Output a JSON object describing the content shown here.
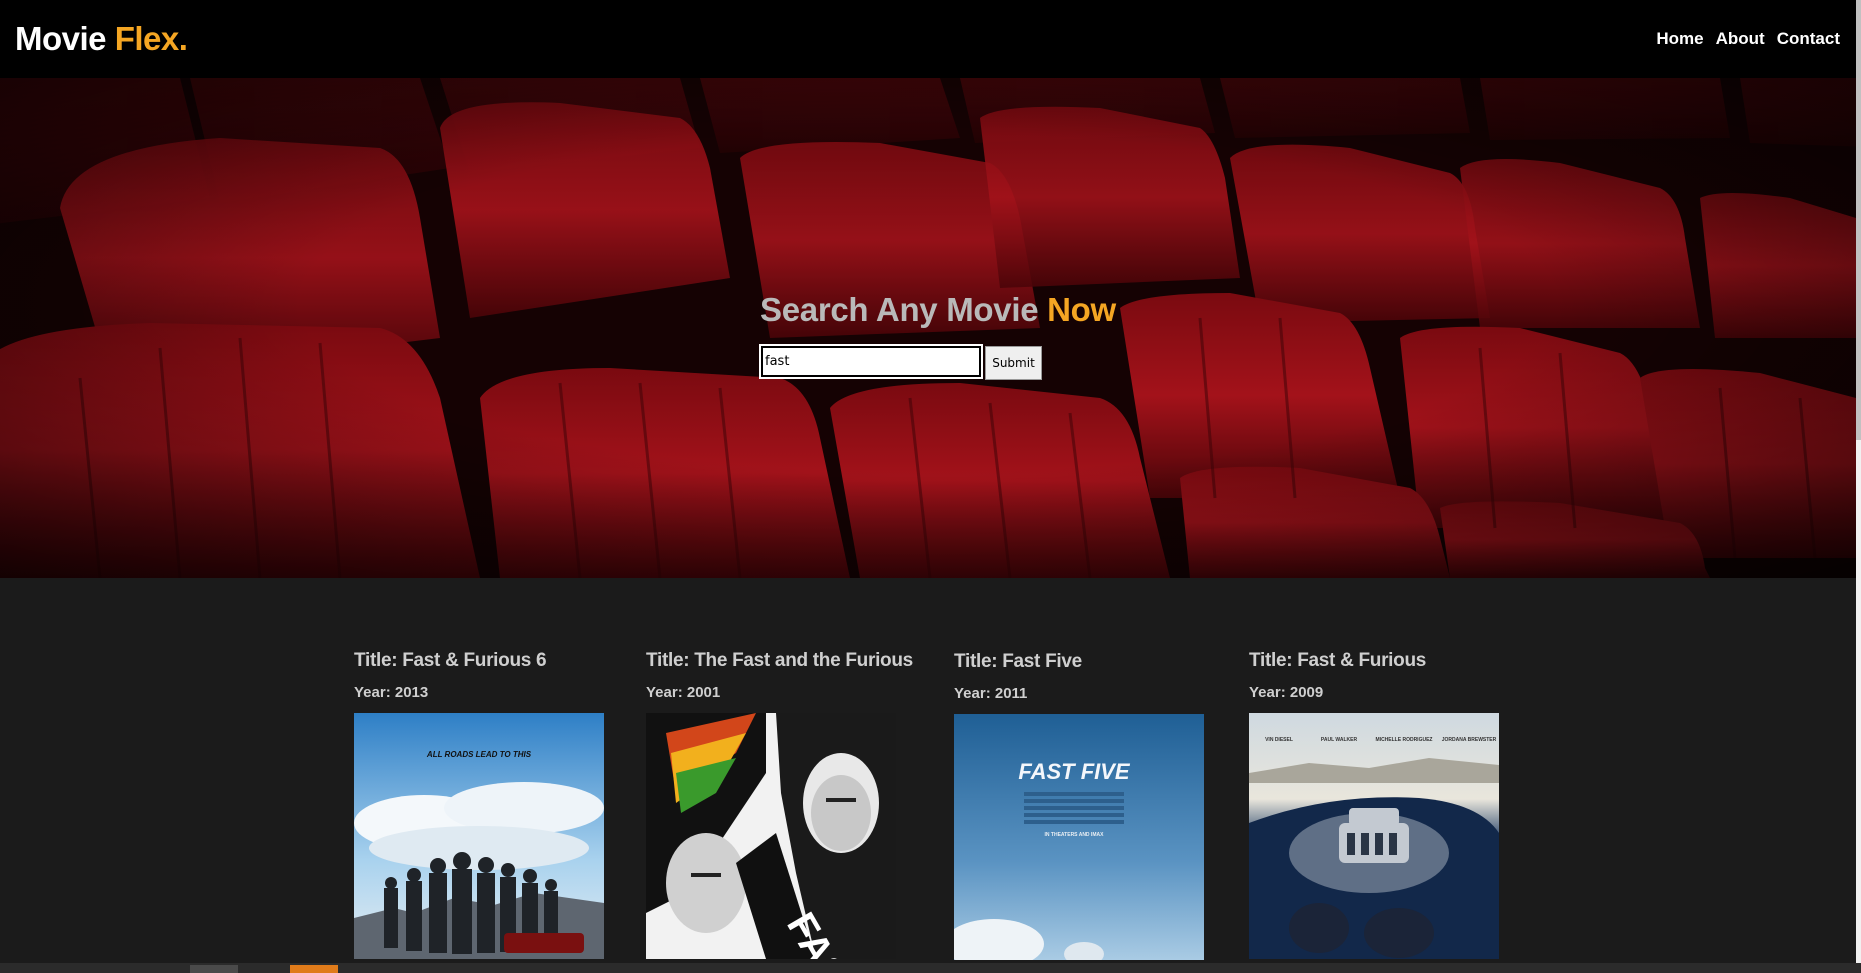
{
  "header": {
    "logo_main": "Movie ",
    "logo_accent": "Flex.",
    "nav": [
      "Home",
      "About",
      "Contact"
    ]
  },
  "hero": {
    "title_main": "Search Any Movie ",
    "title_accent": "Now",
    "search_value": "fast",
    "submit_label": "Submit"
  },
  "movies": [
    {
      "title": "Title: Fast & Furious 6",
      "year": "Year: 2013",
      "tagline": "ALL ROADS LEAD TO THIS"
    },
    {
      "title": "Title: The Fast and the Furious",
      "year": "Year: 2001"
    },
    {
      "title": "Title: Fast Five",
      "year": "Year: 2011",
      "poster_title": "FAST FIVE",
      "poster_credit": "IN THEATERS AND IMAX"
    },
    {
      "title": "Title: Fast & Furious",
      "year": "Year: 2009",
      "poster_names": [
        "VIN DIESEL",
        "PAUL WALKER",
        "MICHELLE RODRIGUEZ",
        "JORDANA BREWSTER"
      ]
    }
  ],
  "colors": {
    "accent": "#f5a623",
    "header_bg": "#000000",
    "results_bg": "#1b1b1b",
    "seat_red": "#8e0d14"
  }
}
